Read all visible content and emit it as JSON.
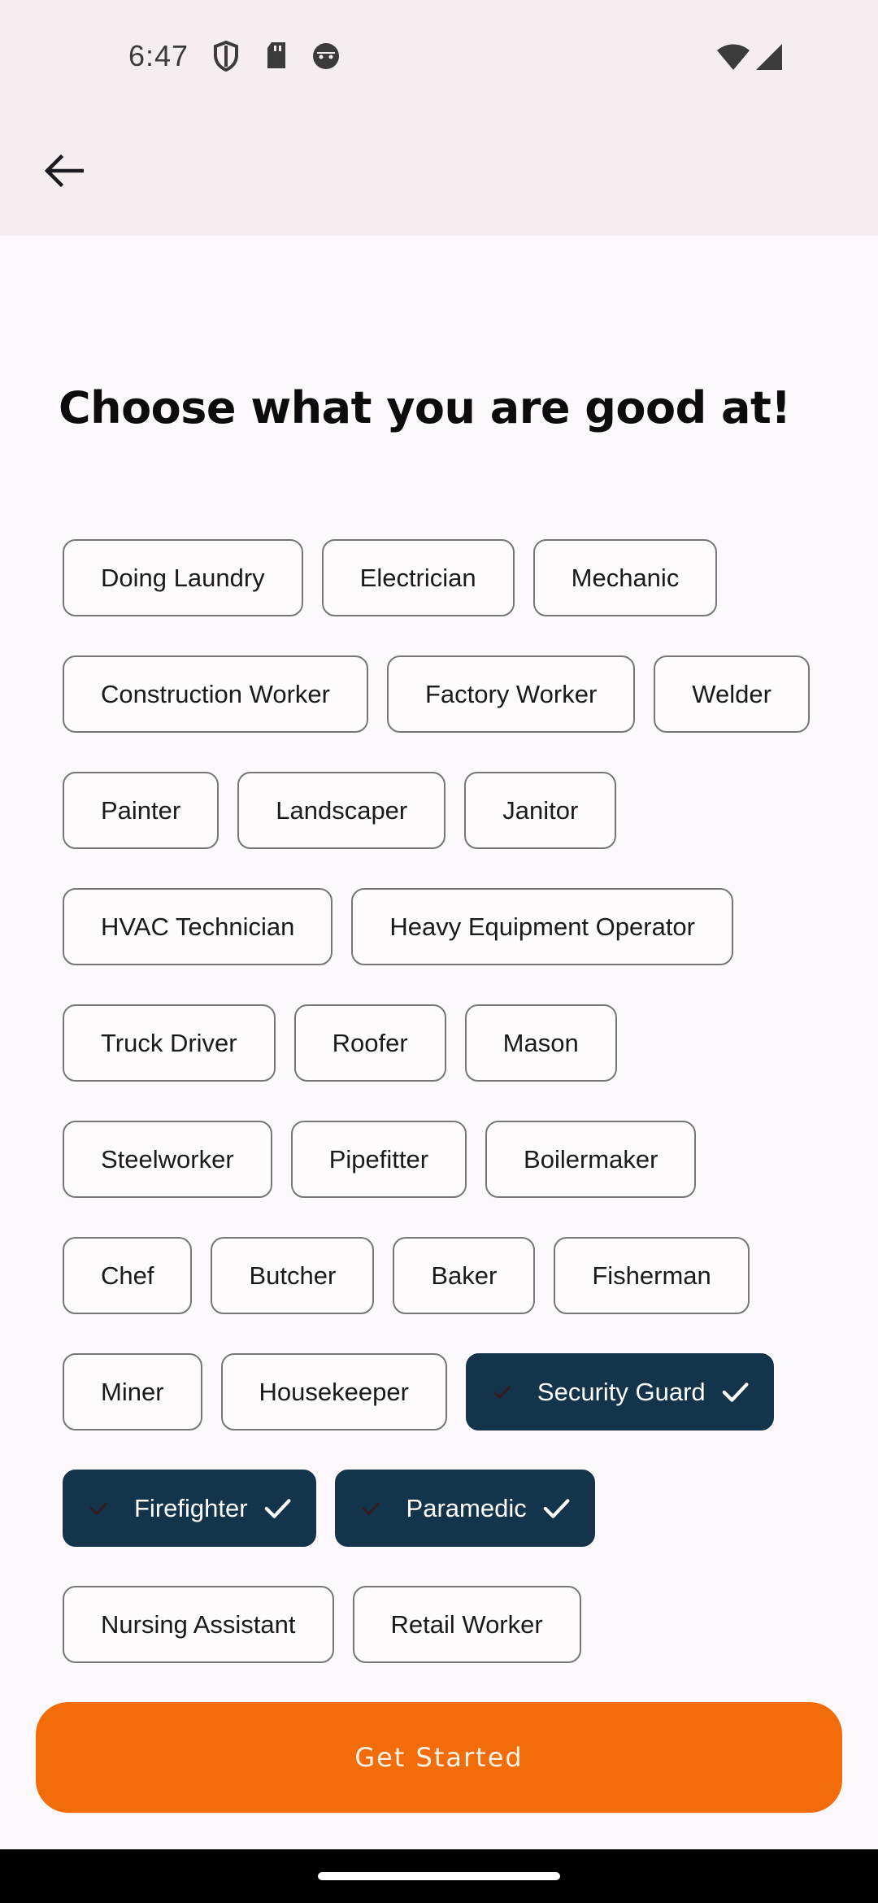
{
  "status_bar": {
    "time": "6:47",
    "icons": [
      "shield-icon",
      "sd-card-icon",
      "face-icon",
      "wifi-icon",
      "cellular-signal-icon"
    ]
  },
  "app_bar": {
    "back_icon": "arrow-left-icon"
  },
  "page": {
    "title": "Choose what you are good at!"
  },
  "skills": [
    {
      "label": "Doing Laundry",
      "selected": false
    },
    {
      "label": "Electrician",
      "selected": false
    },
    {
      "label": "Mechanic",
      "selected": false
    },
    {
      "label": "Construction Worker",
      "selected": false
    },
    {
      "label": "Factory Worker",
      "selected": false
    },
    {
      "label": "Welder",
      "selected": false
    },
    {
      "label": "Painter",
      "selected": false
    },
    {
      "label": "Landscaper",
      "selected": false
    },
    {
      "label": "Janitor",
      "selected": false
    },
    {
      "label": "HVAC Technician",
      "selected": false
    },
    {
      "label": "Heavy Equipment Operator",
      "selected": false
    },
    {
      "label": "Truck Driver",
      "selected": false
    },
    {
      "label": "Roofer",
      "selected": false
    },
    {
      "label": "Mason",
      "selected": false
    },
    {
      "label": "Steelworker",
      "selected": false
    },
    {
      "label": "Pipefitter",
      "selected": false
    },
    {
      "label": "Boilermaker",
      "selected": false
    },
    {
      "label": "Chef",
      "selected": false
    },
    {
      "label": "Butcher",
      "selected": false
    },
    {
      "label": "Baker",
      "selected": false
    },
    {
      "label": "Fisherman",
      "selected": false
    },
    {
      "label": "Miner",
      "selected": false
    },
    {
      "label": "Housekeeper",
      "selected": false
    },
    {
      "label": "Security Guard",
      "selected": true
    },
    {
      "label": "Firefighter",
      "selected": true
    },
    {
      "label": "Paramedic",
      "selected": true
    },
    {
      "label": "Nursing Assistant",
      "selected": false
    },
    {
      "label": "Retail Worker",
      "selected": false
    }
  ],
  "cta": {
    "label": "Get Started"
  },
  "colors": {
    "selected_chip": "#14344c",
    "cta": "#f36c0a",
    "header_bg": "#f5eef1"
  }
}
